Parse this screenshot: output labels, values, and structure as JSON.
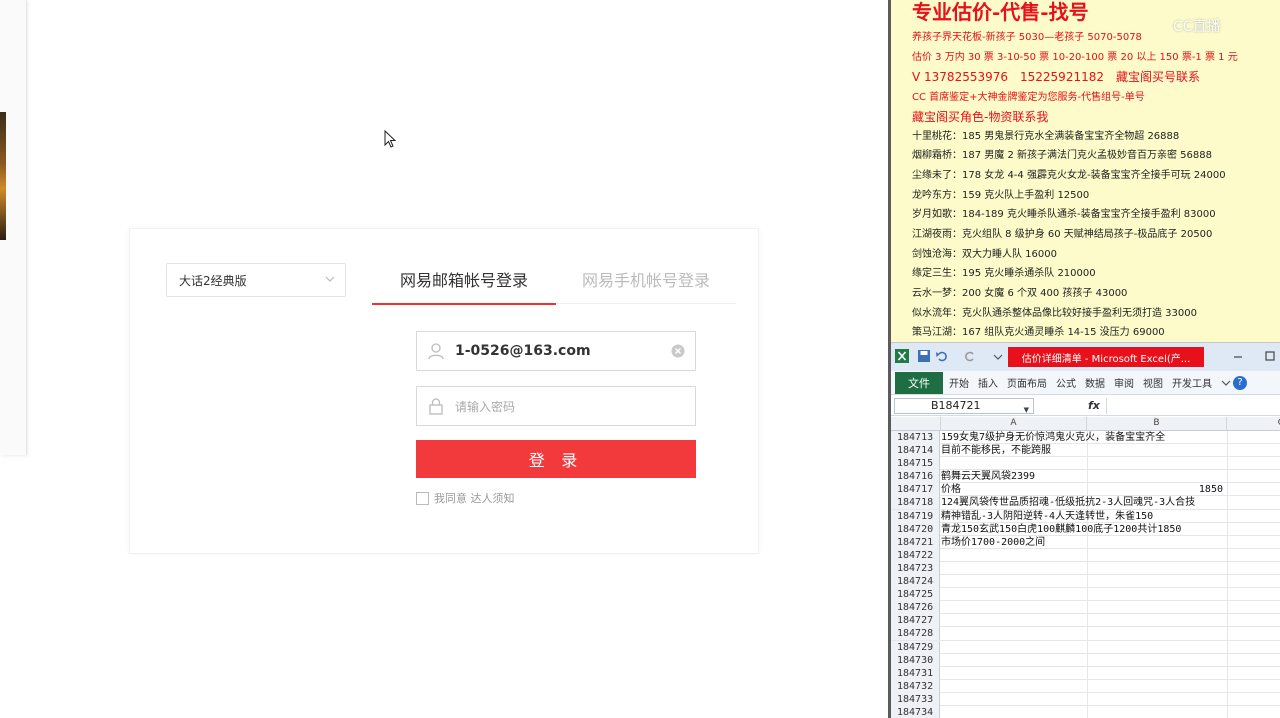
{
  "login": {
    "game_select": "大话2经典版",
    "tab_email": "网易邮箱帐号登录",
    "tab_phone": "网易手机帐号登录",
    "username_value": "1-0526@163.com",
    "password_placeholder": "请输入密码",
    "login_button": "登 录",
    "agree_label": "我同意 达人须知"
  },
  "ad": {
    "title": "专业估价-代售-找号",
    "lines": [
      "养孩子界天花板-新孩子 5030—老孩子 5070-5078",
      "估价 3 万内 30 票 3-10-50 票 10-20-100 票 20 以上 150 票-1 票 1 元",
      "V 13782553976　15225921182　藏宝阁买号联系",
      "CC 首席鉴定+大神金牌鉴定为您服务-代售组号-单号",
      "藏宝阁买角色-物资联系我",
      "十里桃花：185 男鬼景行克水全满装备宝宝齐全物超 26888",
      "烟柳霜桥：187 男魔 2 新孩子满法门克火孟极妙音百万亲密 56888",
      "尘缘未了：178 女龙 4-4 强霹克火女龙-装备宝宝齐全接手可玩 24000",
      "龙吟东方：159 克火队上手盈利 12500",
      "岁月如歌：184-189 克火睡杀队通杀-装备宝宝齐全接手盈利 83000",
      "江湖夜雨：克火组队 8 级护身 60 天赋神结局孩子-极品底子 20500",
      "剑蚀沧海：双大力睡人队 16000",
      "缘定三生：195 克火睡杀通杀队 210000",
      "云水一梦：200 女魔 6 个双 400 孩孩子 43000",
      "似水流年：克火队通杀整体品像比较好接手盈利无须打造 33000",
      "策马江湖：167 组队克火通灵睡杀 14-15 没压力 69000"
    ],
    "watermark": "CC直播"
  },
  "excel": {
    "doc_title": "估价详细清单 - Microsoft Excel(产...",
    "file_tab": "文件",
    "tabs": [
      "开始",
      "插入",
      "页面布局",
      "公式",
      "数据",
      "审阅",
      "视图",
      "开发工具"
    ],
    "help": "?",
    "name_box": "B184721",
    "fx": "fx",
    "col_a": "A",
    "col_b": "B",
    "col_c": "C",
    "rows": [
      {
        "n": "184713",
        "a": "159女鬼7级护身无价惊鸿鬼火克火，装备宝宝齐全",
        "b": ""
      },
      {
        "n": "184714",
        "a": "目前不能移民，不能跨服",
        "b": ""
      },
      {
        "n": "184715",
        "a": "",
        "b": ""
      },
      {
        "n": "184716",
        "a": "鹤舞云天翼风袋2399",
        "b": ""
      },
      {
        "n": "184717",
        "a": "价格",
        "b": "1850"
      },
      {
        "n": "184718",
        "a": "124翼风袋传世品质招魂-低级抵抗2-3人回魂咒-3人合技",
        "b": ""
      },
      {
        "n": "184719",
        "a": "精神错乱-3人阴阳逆转-4人天逢转世，朱雀150",
        "b": ""
      },
      {
        "n": "184720",
        "a": "青龙150玄武150白虎100麒麟100底子1200共计1850",
        "b": ""
      },
      {
        "n": "184721",
        "a": "市场价1700-2000之间",
        "b": ""
      },
      {
        "n": "184722",
        "a": "",
        "b": ""
      },
      {
        "n": "184723",
        "a": "",
        "b": ""
      },
      {
        "n": "184724",
        "a": "",
        "b": ""
      },
      {
        "n": "184725",
        "a": "",
        "b": ""
      },
      {
        "n": "184726",
        "a": "",
        "b": ""
      },
      {
        "n": "184727",
        "a": "",
        "b": ""
      },
      {
        "n": "184728",
        "a": "",
        "b": ""
      },
      {
        "n": "184729",
        "a": "",
        "b": ""
      },
      {
        "n": "184730",
        "a": "",
        "b": ""
      },
      {
        "n": "184731",
        "a": "",
        "b": ""
      },
      {
        "n": "184732",
        "a": "",
        "b": ""
      },
      {
        "n": "184733",
        "a": "",
        "b": ""
      },
      {
        "n": "184734",
        "a": "",
        "b": ""
      }
    ]
  }
}
